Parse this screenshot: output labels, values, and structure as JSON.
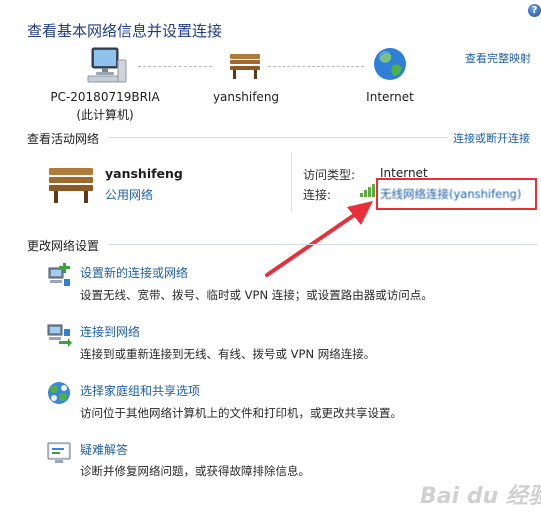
{
  "header": {
    "title": "查看基本网络信息并设置连接",
    "full_map_link": "查看完整映射",
    "help_label": "?"
  },
  "map": {
    "computer_name": "PC-20180719BRIA",
    "computer_sub": "(此计算机)",
    "network_name": "yanshifeng",
    "internet_label": "Internet"
  },
  "active": {
    "section_title": "查看活动网络",
    "connect_link": "连接或断开连接",
    "network_name": "yanshifeng",
    "network_type_link": "公用网络",
    "access_type_label": "访问类型:",
    "access_type_value": "Internet",
    "connection_label": "连接:",
    "connection_value": "无线网络连接(yanshifeng)"
  },
  "settings": {
    "section_title": "更改网络设置",
    "tasks": [
      {
        "title": "设置新的连接或网络",
        "desc": "设置无线、宽带、拨号、临时或 VPN 连接；或设置路由器或访问点。",
        "icon": "new-connection-icon"
      },
      {
        "title": "连接到网络",
        "desc": "连接到或重新连接到无线、有线、拨号或 VPN 网络连接。",
        "icon": "connect-network-icon"
      },
      {
        "title": "选择家庭组和共享选项",
        "desc": "访问位于其他网络计算机上的文件和打印机，或更改共享设置。",
        "icon": "homegroup-icon"
      },
      {
        "title": "疑难解答",
        "desc": "诊断并修复网络问题，或获得故障排除信息。",
        "icon": "troubleshoot-icon"
      }
    ]
  },
  "watermark": "Bai du 经验",
  "colors": {
    "link": "#1e60a8",
    "title": "#1e3e88",
    "annotation_red": "#e8303a"
  }
}
